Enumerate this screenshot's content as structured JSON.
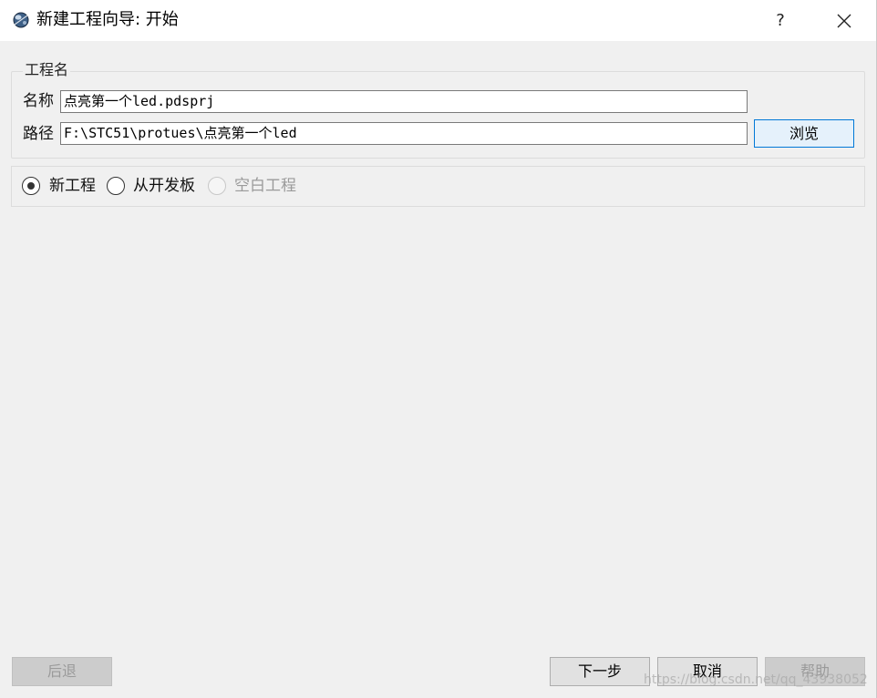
{
  "window": {
    "title": "新建工程向导: 开始",
    "help_label": "?",
    "app_icon": "proteus-app-icon",
    "close_icon": "close-icon"
  },
  "project_name_group": {
    "title": "工程名",
    "name_label": "名称",
    "name_value": "点亮第一个led.pdsprj",
    "path_label": "路径",
    "path_value": "F:\\STC51\\protues\\点亮第一个led",
    "browse_label": "浏览"
  },
  "project_type": {
    "options": [
      {
        "label": "新工程",
        "state": "selected"
      },
      {
        "label": "从开发板",
        "state": "unselected"
      },
      {
        "label": "空白工程",
        "state": "disabled"
      }
    ]
  },
  "footer": {
    "back_label": "后退",
    "next_label": "下一步",
    "cancel_label": "取消",
    "help_label": "帮助"
  },
  "watermark": "https://blog.csdn.net/qq_43938052",
  "colors": {
    "dialog_bg": "#f0f0f0",
    "titlebar_bg": "#ffffff",
    "focus_border": "#0078d7",
    "focus_fill": "#e5f1fb"
  }
}
